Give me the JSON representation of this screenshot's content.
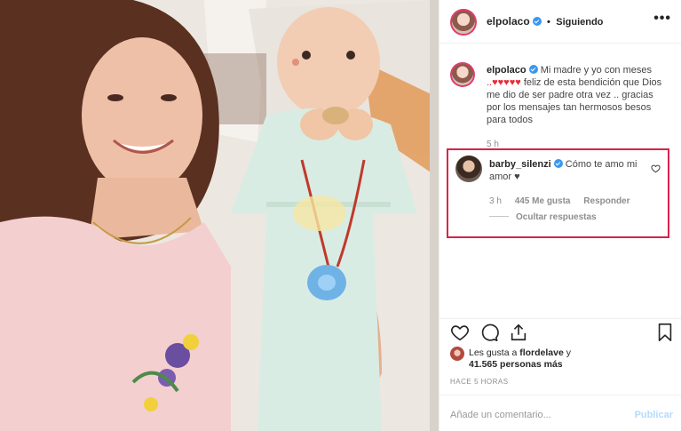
{
  "header": {
    "username": "elpolaco",
    "separator": "•",
    "follow_status": "Siguiendo",
    "more": "•••"
  },
  "caption": {
    "username": "elpolaco",
    "line1": "Mi madre y yo con meses",
    "hearts": "..♥♥♥♥♥",
    "rest": " feliz de esta bendición que Dios me dio de ser padre otra vez .. gracias por los mensajes tan hermosos besos para todos",
    "time": "5 h"
  },
  "comment": {
    "username": "barby_silenzi",
    "text": "Cómo te amo mi amor ♥",
    "time": "3 h",
    "likes": "445 Me gusta",
    "reply": "Responder",
    "hide_replies": "Ocultar respuestas"
  },
  "likes": {
    "prefix": "Les gusta a ",
    "user": "flordelave",
    "connector": " y",
    "count": "41.565 personas más"
  },
  "posted_ago": "HACE 5 HORAS",
  "comment_input": {
    "placeholder": "Añade un comentario...",
    "publish": "Publicar"
  },
  "icons": [
    "verified-badge-icon",
    "more-options-icon",
    "heart-icon",
    "comment-icon",
    "share-icon",
    "bookmark-icon"
  ],
  "colors": {
    "verified": "#3897f0",
    "highlight_border": "#d9234a",
    "publish_disabled": "#b3dbff"
  }
}
